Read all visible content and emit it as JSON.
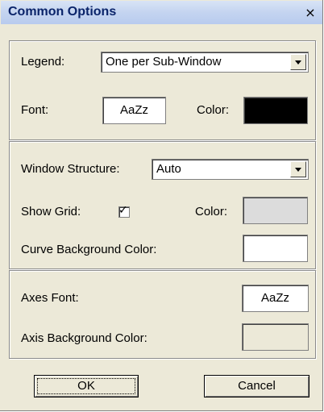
{
  "window": {
    "title": "Common Options",
    "close_glyph": "×"
  },
  "legend": {
    "label": "Legend:",
    "value": "One per Sub-Window"
  },
  "font": {
    "label": "Font:",
    "sample": "AaZz",
    "color_label": "Color:",
    "color": "#000000"
  },
  "window_structure": {
    "label": "Window Structure:",
    "value": "Auto"
  },
  "grid": {
    "label": "Show Grid:",
    "checked": true,
    "check_glyph": "✓",
    "color_label": "Color:",
    "color": "#dcdcdc"
  },
  "curve_bg": {
    "label": "Curve Background Color:",
    "color": "#ffffff"
  },
  "axes_font": {
    "label": "Axes Font:",
    "sample": "AaZz"
  },
  "axis_bg": {
    "label": "Axis Background Color:",
    "color": "#ece9d8"
  },
  "buttons": {
    "ok": "OK",
    "cancel": "Cancel"
  }
}
